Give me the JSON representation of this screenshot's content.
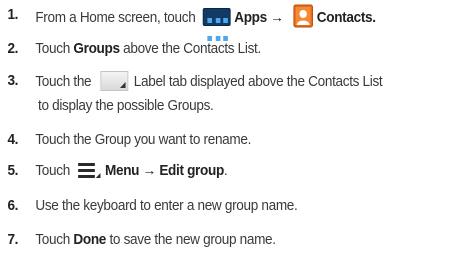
{
  "steps": [
    {
      "number": "1.",
      "text_a": "From a Home screen, touch",
      "apps_label": "Apps",
      "arrow": "→",
      "contacts_label": "Contacts."
    },
    {
      "number": "2.",
      "text_a": "Touch ",
      "groups_label": "Groups",
      "text_b": " above the Contacts List."
    },
    {
      "number": "3.",
      "text_a": "Touch the",
      "text_b": "Label tab displayed above the Contacts List",
      "text_c": "to display the possible Groups."
    },
    {
      "number": "4.",
      "text_a": "Touch the Group you want to rename."
    },
    {
      "number": "5.",
      "text_a": "Touch",
      "menu_label": "Menu",
      "arrow": "→",
      "edit_label": "Edit group",
      "period": "."
    },
    {
      "number": "6.",
      "text_a": "Use the keyboard to enter a new group name."
    },
    {
      "number": "7.",
      "text_a": "Touch ",
      "done_label": "Done",
      "text_b": " to save the new group name."
    }
  ],
  "icons": {
    "apps": "apps-grid-icon",
    "contacts": "contacts-person-icon",
    "label_tab": "label-tab-icon",
    "menu": "menu-icon"
  },
  "colors": {
    "text": "#3a3a3a",
    "apps_icon_bg": "#123a66",
    "contacts_icon_bg": "#e86a1c"
  }
}
